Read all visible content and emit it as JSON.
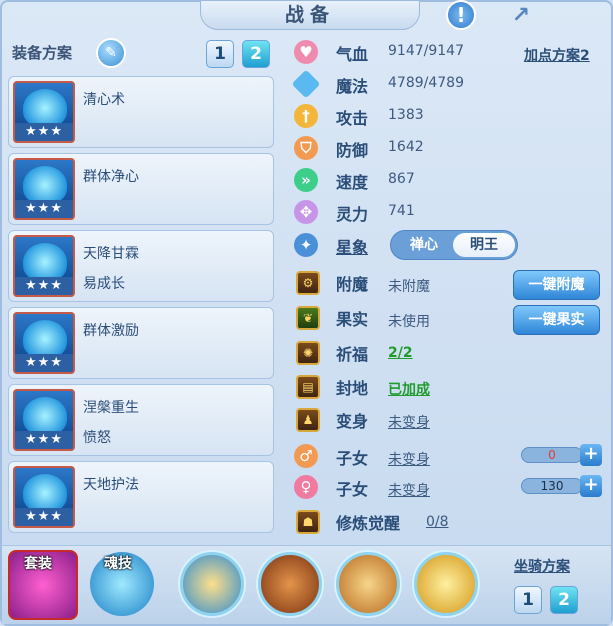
{
  "title": "战备",
  "left": {
    "header": "装备方案",
    "plans": [
      "1",
      "2"
    ],
    "skills": [
      {
        "name": "清心术",
        "sub": "",
        "stars": "★★★"
      },
      {
        "name": "群体净心",
        "sub": "",
        "stars": "★★★"
      },
      {
        "name": "天降甘霖",
        "sub": "易成长",
        "stars": "★★★"
      },
      {
        "name": "群体激励",
        "sub": "",
        "stars": "★★★"
      },
      {
        "name": "涅槃重生",
        "sub": "愤怒",
        "stars": "★★★"
      },
      {
        "name": "天地护法",
        "sub": "",
        "stars": "★★★"
      }
    ]
  },
  "stats": [
    {
      "label": "气血",
      "value": "9147/9147",
      "icon": "heart-icon",
      "color": "#f08bb0"
    },
    {
      "label": "魔法",
      "value": "4789/4789",
      "icon": "diamond-icon",
      "color": "#5ab9f0"
    },
    {
      "label": "攻击",
      "value": "1383",
      "icon": "sword-icon",
      "color": "#f4b63a"
    },
    {
      "label": "防御",
      "value": "1642",
      "icon": "shield-icon",
      "color": "#f39a52"
    },
    {
      "label": "速度",
      "value": "867",
      "icon": "speed-icon",
      "color": "#3ccf8a"
    },
    {
      "label": "灵力",
      "value": "741",
      "icon": "spirit-icon",
      "color": "#c795e8"
    }
  ],
  "addpoint_link": "加点方案2",
  "star": {
    "label": "星象",
    "options": [
      "禅心",
      "明王"
    ],
    "selected": 1
  },
  "extras": [
    {
      "label": "附魔",
      "value": "未附魔",
      "button": "一键附魔"
    },
    {
      "label": "果实",
      "value": "未使用",
      "button": "一键果实"
    },
    {
      "label": "祈福",
      "value": "2/2"
    },
    {
      "label": "封地",
      "value": "已加成"
    },
    {
      "label": "变身",
      "value": "未变身"
    }
  ],
  "children": [
    {
      "label": "子女",
      "value": "未变身",
      "bar": "0"
    },
    {
      "label": "子女",
      "value": "未变身",
      "bar": "130"
    }
  ],
  "cultivation": {
    "label": "修炼觉醒",
    "value": "0/8"
  },
  "bottom": {
    "set_label": "套装",
    "soul_label": "魂技",
    "mount_label": "坐骑方案",
    "mount_plans": [
      "1",
      "2"
    ]
  }
}
